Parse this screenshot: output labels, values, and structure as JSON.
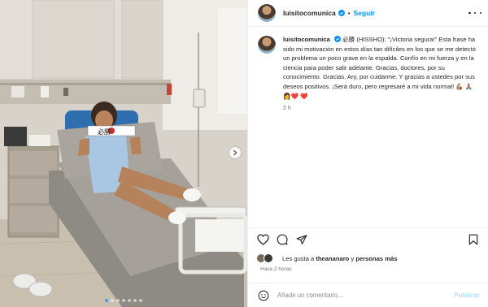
{
  "post": {
    "username": "luisitocomunica",
    "separator": "•",
    "follow_label": "Seguir",
    "caption_username": "luisitocomunica",
    "caption_text": "必勝 (HISSHO): \"¡Victoria segura!\" Esta frase ha sido mi motivación en estos días tan difíciles en los que se me detectó un problema un poco grave en la espalda. Confío en mi fuerza y en la ciencia para poder salir adelante. Gracias, doctores, por su conocimiento. Gracias, Ary, por cuidarme. Y gracias a ustedes por sus deseos positivos. ¡Será duro, pero regresaré a mi vida normal! 💪🏽 🙏🏽 👩‍❤️ ❤️",
    "caption_time": "2 h",
    "likes_prefix": "Les gusta a ",
    "likes_user": "theananaro",
    "likes_middle": " y ",
    "likes_others": "personas más",
    "post_date": "Hace 2 horas",
    "comment_placeholder": "Añade un comentario...",
    "publish_label": "Publicar",
    "headband_text": "必勝",
    "carousel": {
      "count": 7,
      "active": 0
    }
  },
  "icons": {
    "verified": "verified-badge-icon",
    "more": "more-options-icon",
    "like": "heart-icon",
    "comment": "comment-icon",
    "share": "share-icon",
    "save": "bookmark-icon",
    "emoji": "emoji-icon",
    "next": "chevron-right-icon"
  },
  "colors": {
    "accent": "#0095f6",
    "publish_disabled": "#b2dffc",
    "verified": "#0095f6",
    "secondary_text": "#737373"
  }
}
